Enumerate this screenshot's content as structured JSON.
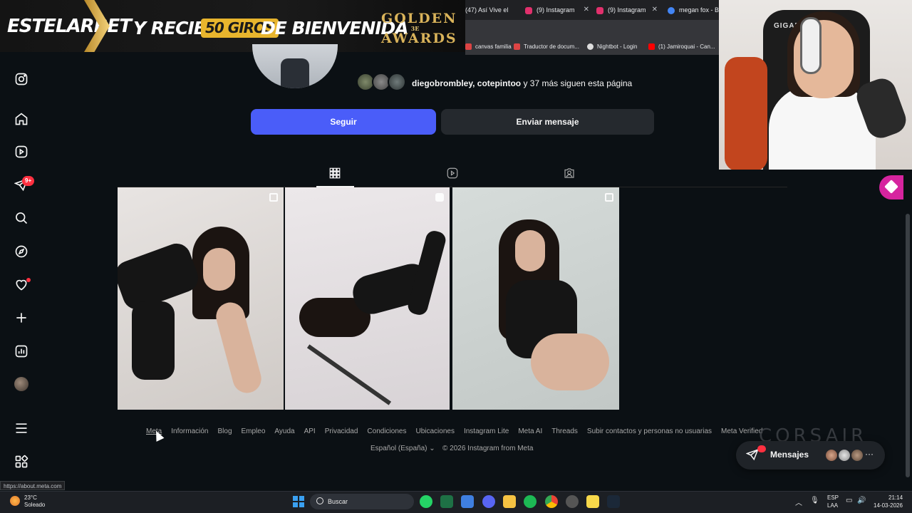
{
  "banner": {
    "brand": "ESTELARBET",
    "promo_prefix": "Y RECIBE",
    "promo_highlight": "50 GIROS",
    "promo_suffix": "DE BIENVENIDA",
    "award_line1": "GOLDEN",
    "award_sub": "3E",
    "award_line2": "AWARDS"
  },
  "browser": {
    "tabs": [
      {
        "label": "(47) Así Vive el",
        "icon": "youtube-icon",
        "color": "#ff0000"
      },
      {
        "label": "(9) Instagram",
        "icon": "instagram-icon",
        "color": "#e1306c"
      },
      {
        "label": "(9) Instagram",
        "icon": "instagram-icon",
        "color": "#e1306c"
      },
      {
        "label": "megan fox - B",
        "icon": "google-icon",
        "color": "#4285f4"
      }
    ],
    "bookmarks": [
      {
        "label": "canvas familia",
        "color": "#d44"
      },
      {
        "label": "Traductor de docum...",
        "color": "#d44"
      },
      {
        "label": "Nightbot - Login",
        "color": "#ddd"
      },
      {
        "label": "(1) Jamiroquai - Can...",
        "color": "#ff0000"
      }
    ]
  },
  "webcam": {
    "chair_brand": "GIGAB"
  },
  "sidebar": {
    "notifications_badge": "9+"
  },
  "profile": {
    "followers_names": "diegobrombley, cotepintoo",
    "followers_rest": " y 37 más siguen esta página",
    "follow_label": "Seguir",
    "message_label": "Enviar mensaje"
  },
  "footer": {
    "links": [
      "Meta",
      "Información",
      "Blog",
      "Empleo",
      "Ayuda",
      "API",
      "Privacidad",
      "Condiciones",
      "Ubicaciones",
      "Instagram Lite",
      "Meta AI",
      "Threads",
      "Subir contactos y personas no usuarias",
      "Meta Verified"
    ],
    "language": "Español (España) ⌄",
    "copyright": "© 2026 Instagram from Meta"
  },
  "messages": {
    "label": "Mensajes"
  },
  "watermark": "CORSAIR",
  "status_url": "https://about.meta.com",
  "taskbar": {
    "temp": "23°C",
    "weather": "Soleado",
    "search_placeholder": "Buscar",
    "lang_line1": "ESP",
    "lang_line2": "LAA",
    "time": "21:14",
    "date": "14-03-2026"
  }
}
